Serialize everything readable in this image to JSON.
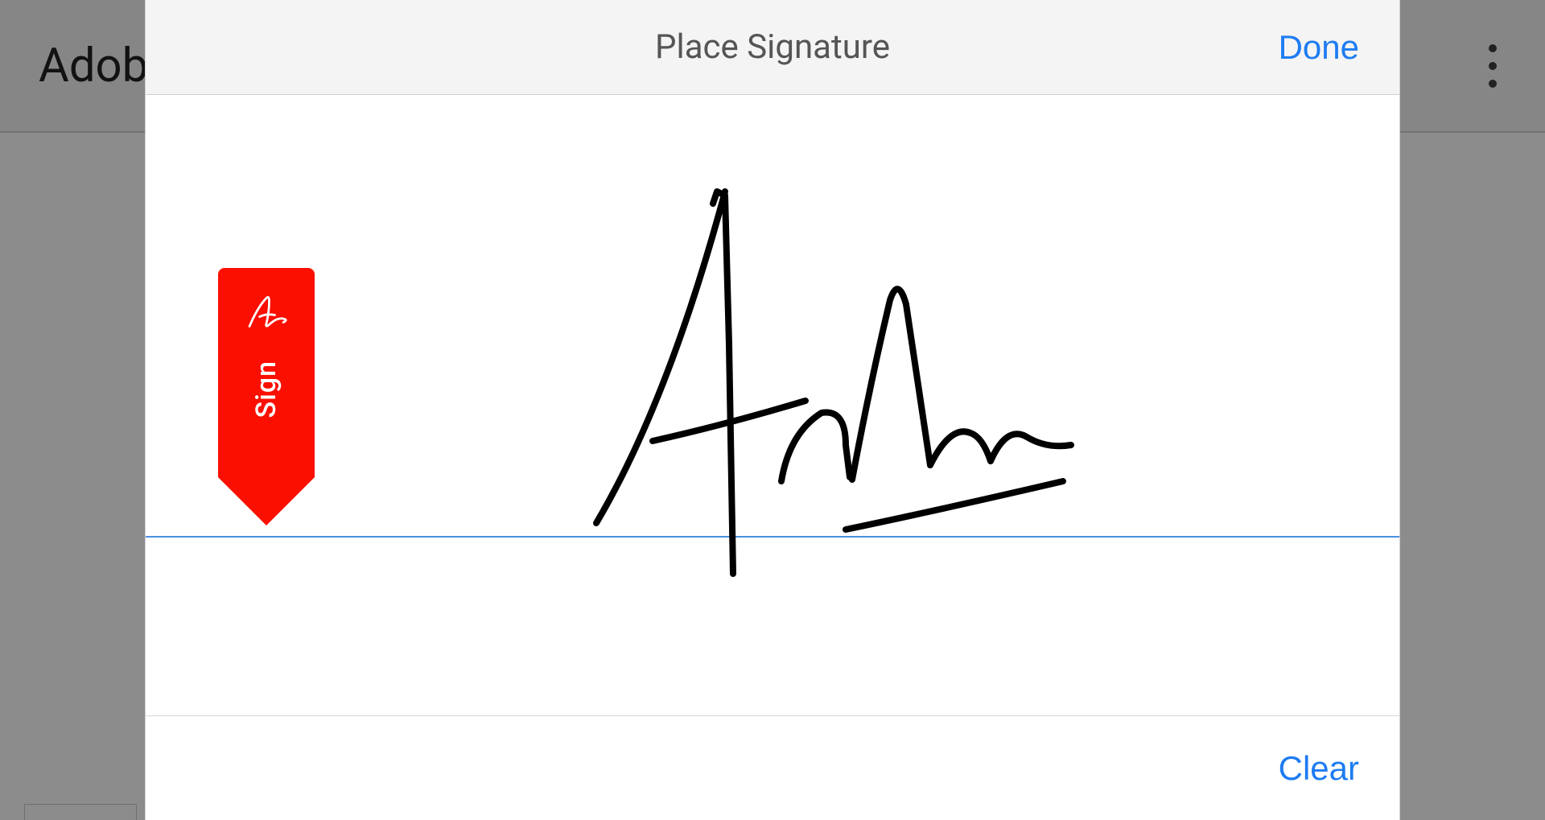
{
  "app": {
    "background_title": "Adob"
  },
  "modal": {
    "title": "Place Signature",
    "done_label": "Done",
    "clear_label": "Clear",
    "marker_label": "Sign"
  },
  "colors": {
    "accent": "#1e7cf2",
    "adobe_red": "#fa0f00",
    "baseline": "#4a90e2"
  }
}
